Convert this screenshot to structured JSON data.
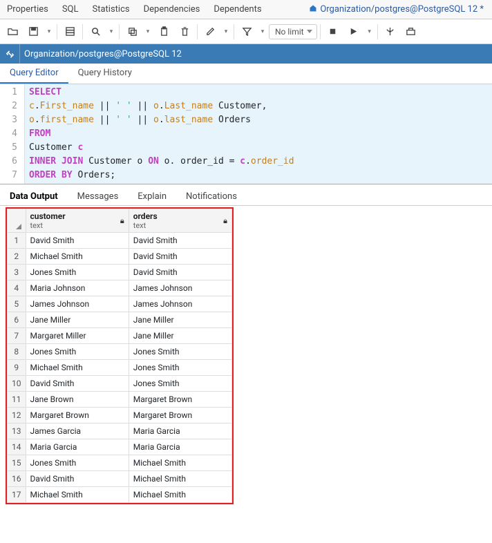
{
  "top_tabs": {
    "properties": "Properties",
    "sql": "SQL",
    "statistics": "Statistics",
    "dependencies": "Dependencies",
    "dependents": "Dependents",
    "file_tab": "Organization/postgres@PostgreSQL 12 *"
  },
  "toolbar": {
    "limit_label": "No limit"
  },
  "connection": {
    "text": "Organization/postgres@PostgreSQL 12"
  },
  "query_tabs": {
    "editor": "Query Editor",
    "history": "Query History"
  },
  "sql_lines": [
    {
      "raw": "SELECT",
      "tokens": [
        {
          "t": "SELECT",
          "c": "kw"
        }
      ]
    },
    {
      "raw": "c.First_name || ' ' || o.Last_name Customer,",
      "tokens": [
        {
          "t": "c",
          "c": "id"
        },
        {
          "t": ".",
          "c": ""
        },
        {
          "t": "First_name",
          "c": "id"
        },
        {
          "t": " || ",
          "c": ""
        },
        {
          "t": "' '",
          "c": "str"
        },
        {
          "t": " || ",
          "c": ""
        },
        {
          "t": "o",
          "c": "id"
        },
        {
          "t": ".",
          "c": ""
        },
        {
          "t": "Last_name",
          "c": "id"
        },
        {
          "t": " Customer,",
          "c": ""
        }
      ]
    },
    {
      "raw": "o.first_name || ' ' || o.last_name Orders",
      "tokens": [
        {
          "t": "o",
          "c": "id"
        },
        {
          "t": ".",
          "c": ""
        },
        {
          "t": "first_name",
          "c": "id"
        },
        {
          "t": " || ",
          "c": ""
        },
        {
          "t": "' '",
          "c": "str"
        },
        {
          "t": " || ",
          "c": ""
        },
        {
          "t": "o",
          "c": "id"
        },
        {
          "t": ".",
          "c": ""
        },
        {
          "t": "last_name",
          "c": "id"
        },
        {
          "t": " Orders",
          "c": ""
        }
      ]
    },
    {
      "raw": "FROM",
      "tokens": [
        {
          "t": "FROM",
          "c": "kw"
        }
      ]
    },
    {
      "raw": "Customer c",
      "tokens": [
        {
          "t": "Customer ",
          "c": ""
        },
        {
          "t": "c",
          "c": "kw"
        }
      ]
    },
    {
      "raw": "INNER JOIN Customer o ON o. order_id = c.order_id",
      "tokens": [
        {
          "t": "INNER JOIN",
          "c": "kw"
        },
        {
          "t": " Customer o ",
          "c": ""
        },
        {
          "t": "ON",
          "c": "kw"
        },
        {
          "t": " o. order_id = ",
          "c": ""
        },
        {
          "t": "c",
          "c": "kw"
        },
        {
          "t": ".",
          "c": ""
        },
        {
          "t": "order_id",
          "c": "id"
        }
      ]
    },
    {
      "raw": "ORDER BY Orders;",
      "tokens": [
        {
          "t": "ORDER BY",
          "c": "kw"
        },
        {
          "t": " Orders;",
          "c": ""
        }
      ]
    }
  ],
  "output_tabs": {
    "data": "Data Output",
    "messages": "Messages",
    "explain": "Explain",
    "notifications": "Notifications"
  },
  "columns": [
    {
      "name": "customer",
      "type": "text"
    },
    {
      "name": "orders",
      "type": "text"
    }
  ],
  "rows": [
    {
      "n": 1,
      "customer": "David Smith",
      "orders": "David Smith"
    },
    {
      "n": 2,
      "customer": "Michael Smith",
      "orders": "David Smith"
    },
    {
      "n": 3,
      "customer": "Jones Smith",
      "orders": "David Smith"
    },
    {
      "n": 4,
      "customer": "Maria Johnson",
      "orders": "James  Johnson"
    },
    {
      "n": 5,
      "customer": "James  Johnson",
      "orders": "James  Johnson"
    },
    {
      "n": 6,
      "customer": "Jane Miller",
      "orders": "Jane Miller"
    },
    {
      "n": 7,
      "customer": "Margaret Miller",
      "orders": "Jane Miller"
    },
    {
      "n": 8,
      "customer": "Jones Smith",
      "orders": "Jones Smith"
    },
    {
      "n": 9,
      "customer": "Michael Smith",
      "orders": "Jones Smith"
    },
    {
      "n": 10,
      "customer": "David Smith",
      "orders": "Jones Smith"
    },
    {
      "n": 11,
      "customer": "Jane Brown",
      "orders": "Margaret Brown"
    },
    {
      "n": 12,
      "customer": "Margaret Brown",
      "orders": "Margaret Brown"
    },
    {
      "n": 13,
      "customer": "James  Garcia",
      "orders": "Maria Garcia"
    },
    {
      "n": 14,
      "customer": "Maria Garcia",
      "orders": "Maria Garcia"
    },
    {
      "n": 15,
      "customer": "Jones Smith",
      "orders": "Michael Smith"
    },
    {
      "n": 16,
      "customer": "David Smith",
      "orders": "Michael Smith"
    },
    {
      "n": 17,
      "customer": "Michael Smith",
      "orders": "Michael Smith"
    }
  ]
}
